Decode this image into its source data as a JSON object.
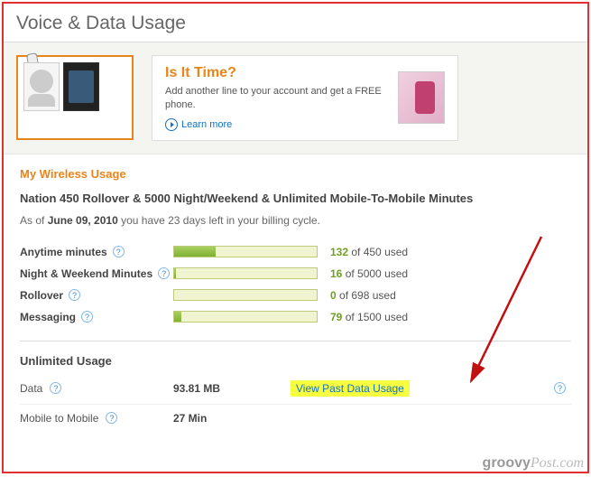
{
  "page_title": "Voice & Data Usage",
  "promo": {
    "title": "Is It Time?",
    "sub": "Add another line to your account and get a FREE phone.",
    "learn": "Learn more"
  },
  "section_title": "My Wireless Usage",
  "plan_name": "Nation 450 Rollover & 5000 Night/Weekend & Unlimited Mobile-To-Mobile Minutes",
  "asof_prefix": "As of ",
  "asof_date": "June 09, 2010",
  "asof_suffix": " you have 23 days left in your billing cycle.",
  "rows": [
    {
      "label": "Anytime minutes",
      "used": "132",
      "of": " of 450 used",
      "pct": 29
    },
    {
      "label": "Night & Weekend Minutes",
      "used": "16",
      "of": " of 5000 used",
      "pct": 1
    },
    {
      "label": "Rollover",
      "used": "0",
      "of": " of 698 used",
      "pct": 0
    },
    {
      "label": "Messaging",
      "used": "79",
      "of": " of 1500 used",
      "pct": 5
    }
  ],
  "unlimited_header": "Unlimited Usage",
  "unl": {
    "data_label": "Data",
    "data_val": "93.81 MB",
    "past_link": "View Past Data Usage",
    "m2m_label": "Mobile to Mobile",
    "m2m_val": "27 Min"
  },
  "watermark": "groovyPost.com"
}
